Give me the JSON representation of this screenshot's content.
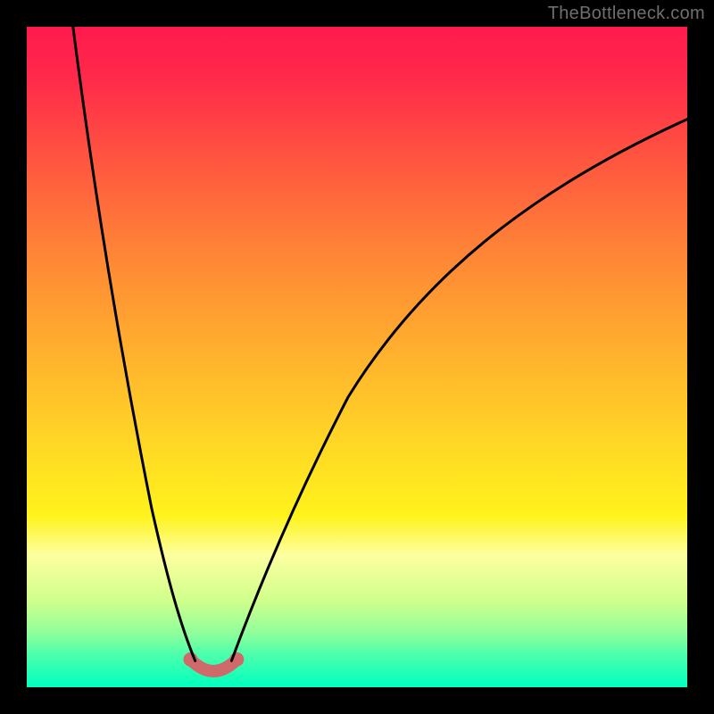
{
  "watermark": "TheBottleneck.com",
  "chart_data": {
    "type": "line",
    "title": "",
    "xlabel": "",
    "ylabel": "",
    "xlim": [
      0,
      100
    ],
    "ylim": [
      0,
      100
    ],
    "grid": false,
    "legend": false,
    "background_gradient_stops": [
      {
        "pct": 0,
        "color": "#ff1a4d"
      },
      {
        "pct": 8,
        "color": "#ff2a4a"
      },
      {
        "pct": 20,
        "color": "#ff5540"
      },
      {
        "pct": 34,
        "color": "#ff8436"
      },
      {
        "pct": 48,
        "color": "#ffad2e"
      },
      {
        "pct": 62,
        "color": "#ffd426"
      },
      {
        "pct": 74,
        "color": "#fff31c"
      },
      {
        "pct": 80,
        "color": "#fdffa0"
      },
      {
        "pct": 87,
        "color": "#cfff8c"
      },
      {
        "pct": 92,
        "color": "#8cff9c"
      },
      {
        "pct": 95,
        "color": "#4dffab"
      },
      {
        "pct": 100,
        "color": "#00ffbf"
      }
    ],
    "series": [
      {
        "name": "left-branch",
        "color": "#000000",
        "stroke_width": 3,
        "x": [
          7,
          10,
          13,
          16,
          19,
          22,
          24,
          25.5
        ],
        "y": [
          100,
          80,
          62,
          46,
          31,
          18,
          9,
          4
        ]
      },
      {
        "name": "right-branch",
        "color": "#000000",
        "stroke_width": 3,
        "x": [
          31,
          33,
          36,
          40,
          45,
          52,
          60,
          70,
          82,
          95,
          100
        ],
        "y": [
          4,
          9,
          18,
          30,
          42,
          54,
          64,
          72,
          79,
          84,
          86
        ]
      },
      {
        "name": "bottom-pink-curve",
        "color": "#d06a6a",
        "stroke_width": 14,
        "x": [
          24.8,
          25.5,
          26.5,
          28,
          29.5,
          31,
          31.8
        ],
        "y": [
          4.2,
          2.0,
          0.9,
          0.5,
          0.9,
          2.0,
          4.2
        ]
      }
    ],
    "markers": [
      {
        "name": "left-endpoint",
        "x": 24.8,
        "y": 4.2,
        "color": "#d06a6a",
        "r": 8
      },
      {
        "name": "right-endpoint",
        "x": 31.8,
        "y": 4.2,
        "color": "#d06a6a",
        "r": 8
      }
    ]
  }
}
